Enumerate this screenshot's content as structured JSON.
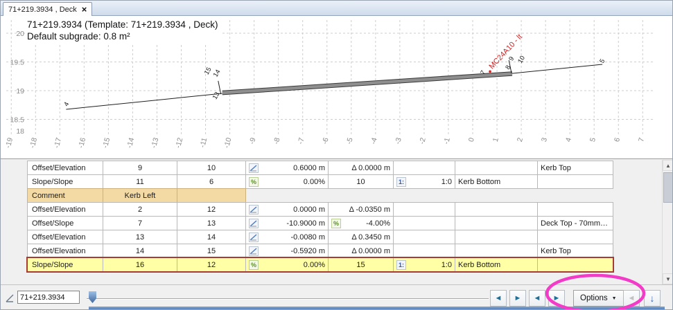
{
  "tab": {
    "label": "71+219.3934 , Deck",
    "close_glyph": "×"
  },
  "chart": {
    "title": "71+219.3934 (Template: 71+219.3934 , Deck)",
    "subtitle": "Default subgrade: 0.8 m²",
    "x_ticks": [
      -19,
      -18,
      -17,
      -16,
      -15,
      -14,
      -13,
      -12,
      -11,
      -10,
      -9,
      -8,
      -7,
      -6,
      -5,
      -4,
      -3,
      -2,
      -1,
      0,
      1,
      2,
      3,
      4,
      5,
      6,
      7
    ],
    "y_ticks": [
      {
        "label": "20",
        "value": 20
      },
      {
        "label": "19.5",
        "value": 19.5
      },
      {
        "label": "19",
        "value": 19
      },
      {
        "label": "18.5",
        "value": 18.5
      },
      {
        "label": "18",
        "value": 18
      }
    ],
    "red_label": {
      "text": "MC24A10 - lt",
      "offset": 0.8,
      "elevation": 19.37,
      "angle": -47
    },
    "section": {
      "lines": [
        {
          "name": "approach-left",
          "thick": false,
          "pts": [
            [
              -16.74,
              18.675
            ],
            [
              -10.31,
              18.952
            ]
          ]
        },
        {
          "name": "deck-top",
          "thick": true,
          "pts": [
            [
              -10.31,
              18.963
            ],
            [
              1.627,
              19.295
            ]
          ]
        },
        {
          "name": "approach-right",
          "thick": false,
          "pts": [
            [
              1.627,
              19.3
            ],
            [
              5.34,
              19.458
            ]
          ]
        },
        {
          "name": "kerb-left",
          "thick": false,
          "pts": [
            [
              -10.37,
              18.94
            ],
            [
              -10.48,
              19.17
            ]
          ]
        },
        {
          "name": "kerb-right",
          "thick": false,
          "pts": [
            [
              1.6,
              19.3
            ],
            [
              1.49,
              19.53
            ]
          ]
        }
      ],
      "point_labels": [
        {
          "text": "4",
          "offset": -16.69,
          "elevation": 18.72
        },
        {
          "text": "13",
          "offset": -10.57,
          "elevation": 18.84
        },
        {
          "text": "15",
          "offset": -10.91,
          "elevation": 19.27
        },
        {
          "text": "14",
          "offset": -10.54,
          "elevation": 19.23
        },
        {
          "text": "7",
          "offset": 0.46,
          "elevation": 19.27
        },
        {
          "text": "8",
          "offset": 1.49,
          "elevation": 19.36
        },
        {
          "text": "9",
          "offset": 1.63,
          "elevation": 19.51
        },
        {
          "text": "10",
          "offset": 2.0,
          "elevation": 19.47
        },
        {
          "text": "5",
          "offset": 5.37,
          "elevation": 19.47
        }
      ]
    }
  },
  "table": {
    "rows": [
      {
        "type": "Offset/Elevation",
        "style": "normal",
        "cells": [
          {
            "t": "9",
            "a": "c"
          },
          {
            "t": "10",
            "a": "c"
          },
          {
            "i": "slope",
            "t": "0.6000 m"
          },
          {
            "t": "Δ 0.0000 m",
            "a": "r"
          },
          {},
          {},
          {
            "t": "Kerb Top",
            "a": "l"
          }
        ]
      },
      {
        "type": "Slope/Slope",
        "style": "normal",
        "cells": [
          {
            "t": "11",
            "a": "c"
          },
          {
            "t": "6",
            "a": "c"
          },
          {
            "i": "pct",
            "t": "0.00%"
          },
          {
            "t": "10",
            "a": "c"
          },
          {
            "i": "ratio",
            "t": "1:0"
          },
          {
            "t": "Kerb Bottom",
            "a": "l"
          },
          {}
        ]
      },
      {
        "type": "Comment",
        "style": "comment",
        "cells": [
          {
            "t": "Kerb Left",
            "a": "c"
          },
          {
            "t": ""
          }
        ]
      },
      {
        "type": "Offset/Elevation",
        "style": "normal",
        "cells": [
          {
            "t": "2",
            "a": "c"
          },
          {
            "t": "12",
            "a": "c"
          },
          {
            "i": "slope",
            "t": "0.0000 m"
          },
          {
            "t": "Δ -0.0350 m",
            "a": "r"
          },
          {},
          {},
          {}
        ]
      },
      {
        "type": "Offset/Slope",
        "style": "normal",
        "cells": [
          {
            "t": "7",
            "a": "c"
          },
          {
            "t": "13",
            "a": "c"
          },
          {
            "i": "slope",
            "t": "-10.9000 m"
          },
          {
            "i": "pct",
            "t": "-4.00%"
          },
          {},
          {},
          {
            "t": "Deck Top - 70mm…",
            "a": "l"
          }
        ]
      },
      {
        "type": "Offset/Elevation",
        "style": "normal",
        "cells": [
          {
            "t": "13",
            "a": "c"
          },
          {
            "t": "14",
            "a": "c"
          },
          {
            "i": "slope",
            "t": "-0.0080 m"
          },
          {
            "t": "Δ 0.3450 m",
            "a": "r"
          },
          {},
          {},
          {}
        ]
      },
      {
        "type": "Offset/Elevation",
        "style": "normal",
        "cells": [
          {
            "t": "14",
            "a": "c"
          },
          {
            "t": "15",
            "a": "c"
          },
          {
            "i": "slope",
            "t": "-0.5920 m"
          },
          {
            "t": "Δ 0.0000 m",
            "a": "r"
          },
          {},
          {},
          {
            "t": "Kerb Top",
            "a": "l"
          }
        ]
      },
      {
        "type": "Slope/Slope",
        "style": "selected",
        "cells": [
          {
            "t": "16",
            "a": "c"
          },
          {
            "t": "12",
            "a": "c"
          },
          {
            "i": "pct",
            "t": "0.00%"
          },
          {
            "t": "15",
            "a": "c"
          },
          {
            "i": "ratio",
            "t": "1:0"
          },
          {
            "t": "Kerb Bottom",
            "a": "l"
          },
          {}
        ]
      }
    ]
  },
  "scrollbar": {
    "up_glyph": "▲",
    "down_glyph": "▼"
  },
  "bottom": {
    "station_value": "71+219.3934",
    "options_label": "Options",
    "options_caret": "▼",
    "nav": [
      {
        "name": "step-back-button",
        "glyph": "◄",
        "style": "teal"
      },
      {
        "name": "step-forward-button",
        "glyph": "►",
        "style": "teal"
      },
      {
        "name": "prev-section-button",
        "glyph": "◄",
        "style": "teal"
      },
      {
        "name": "next-section-button",
        "glyph": "►",
        "style": "teal"
      }
    ],
    "extra": [
      {
        "name": "undo-button",
        "glyph": "◄",
        "style": "disabled"
      },
      {
        "name": "apply-down-button",
        "glyph": "↓",
        "style": "blue"
      }
    ]
  },
  "annotation": {
    "color": "#f23cc8"
  }
}
